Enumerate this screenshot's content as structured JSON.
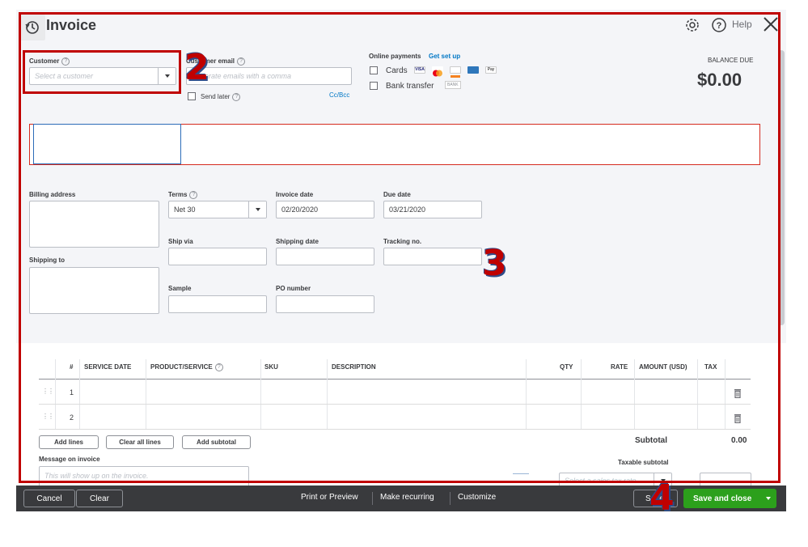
{
  "header": {
    "title": "Invoice",
    "help_label": "Help"
  },
  "customer": {
    "label": "Customer",
    "placeholder": "Select a customer"
  },
  "customer_email": {
    "label": "Customer email",
    "placeholder": "Separate emails with a comma",
    "send_later_label": "Send later",
    "cc_bcc_label": "Cc/Bcc"
  },
  "online_payments": {
    "label": "Online payments",
    "setup_link": "Get set up",
    "cards_label": "Cards",
    "bank_transfer_label": "Bank transfer",
    "bank_badge": "BANK",
    "card_brands": [
      "VISA",
      "mastercard",
      "discover",
      "amex",
      "applepay"
    ]
  },
  "balance": {
    "label": "BALANCE DUE",
    "value": "$0.00"
  },
  "address": {
    "billing_label": "Billing address",
    "shipping_label": "Shipping to"
  },
  "fields": {
    "terms_label": "Terms",
    "terms_value": "Net 30",
    "invoice_date_label": "Invoice date",
    "invoice_date_value": "02/20/2020",
    "due_date_label": "Due date",
    "due_date_value": "03/21/2020",
    "ship_via_label": "Ship via",
    "shipping_date_label": "Shipping date",
    "tracking_label": "Tracking no.",
    "sample_label": "Sample",
    "po_number_label": "PO number"
  },
  "table": {
    "columns": [
      "#",
      "SERVICE DATE",
      "PRODUCT/SERVICE",
      "SKU",
      "DESCRIPTION",
      "QTY",
      "RATE",
      "AMOUNT (USD)",
      "TAX"
    ],
    "rows": [
      {
        "num": "1"
      },
      {
        "num": "2"
      }
    ]
  },
  "table_actions": {
    "add_lines": "Add lines",
    "clear_all_lines": "Clear all lines",
    "add_subtotal": "Add subtotal"
  },
  "totals": {
    "subtotal_label": "Subtotal",
    "subtotal_value": "0.00",
    "taxable_subtotal_label": "Taxable subtotal",
    "sales_tax_placeholder": "Select a sales tax rate"
  },
  "message": {
    "label": "Message on invoice",
    "placeholder": "This will show up on the invoice."
  },
  "footer": {
    "cancel": "Cancel",
    "clear": "Clear",
    "print_preview": "Print or Preview",
    "make_recurring": "Make recurring",
    "customize": "Customize",
    "save_partial": "Save",
    "save_and_close": "Save and close"
  },
  "annotations": {
    "marker_2": "2",
    "marker_3": "3",
    "marker_4": "4"
  },
  "colors": {
    "accent_green": "#2ca01c",
    "link_blue": "#0077c5",
    "annotation_red": "#c00000",
    "footer_dark": "#393a3d"
  }
}
